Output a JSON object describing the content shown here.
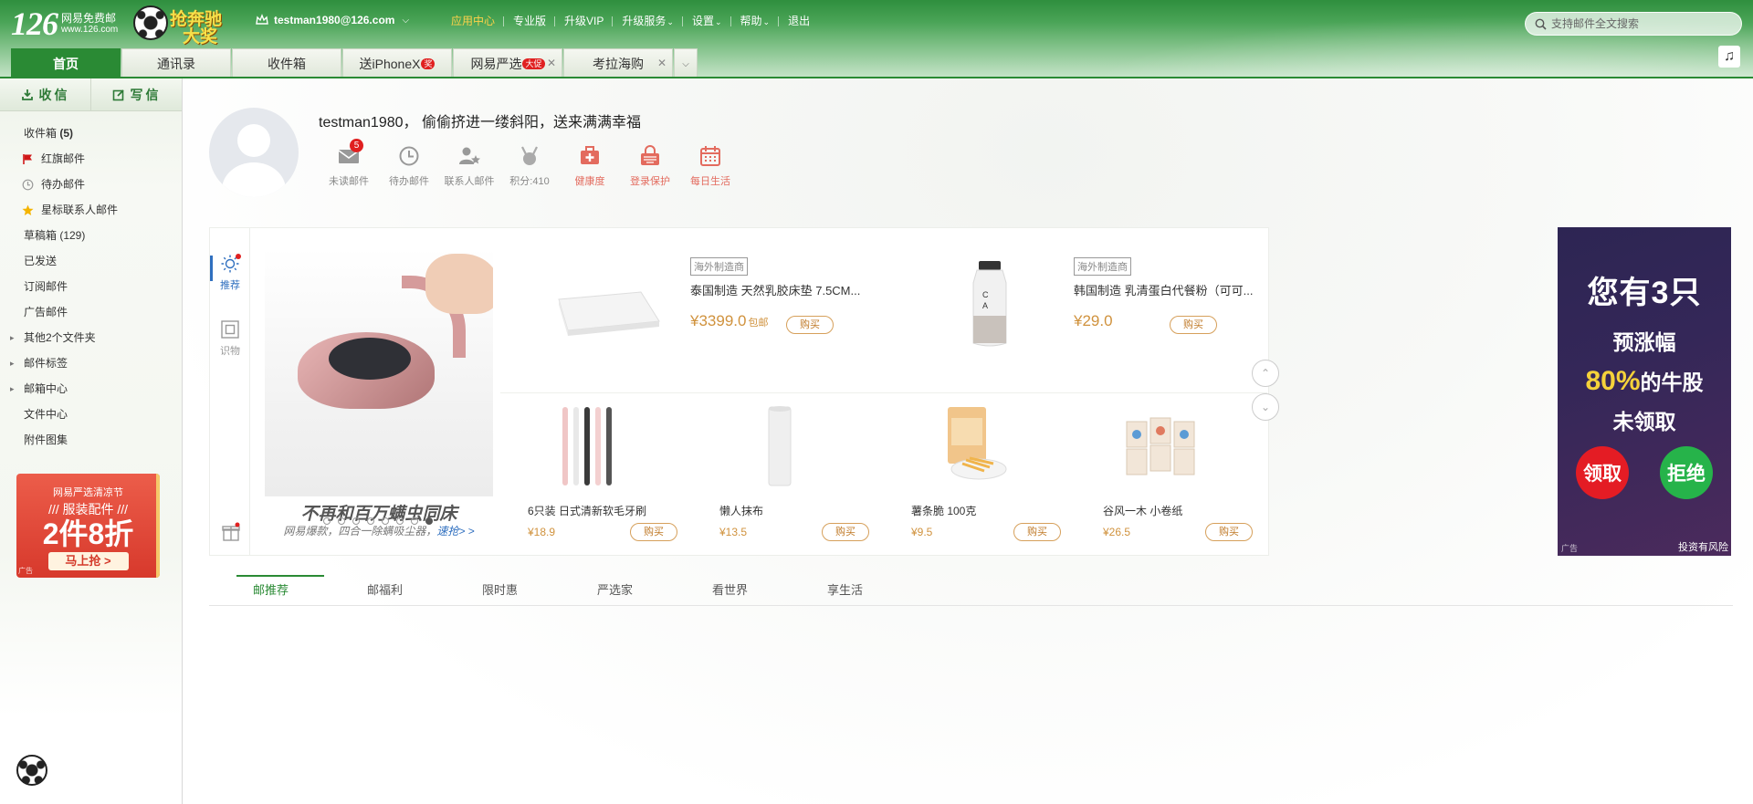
{
  "header": {
    "logo_number": "126",
    "logo_line1": "网易免费邮",
    "logo_line2": "www.126.com",
    "promo_line1": "抢奔驰",
    "promo_line2": "大奖",
    "user_email": "testman1980@126.com",
    "nav": [
      {
        "label": "应用中心",
        "highlight": true,
        "dropdown": false
      },
      {
        "label": "专业版",
        "highlight": false,
        "dropdown": false
      },
      {
        "label": "升级VIP",
        "highlight": false,
        "dropdown": false
      },
      {
        "label": "升级服务",
        "highlight": false,
        "dropdown": true
      },
      {
        "label": "设置",
        "highlight": false,
        "dropdown": true
      },
      {
        "label": "帮助",
        "highlight": false,
        "dropdown": true
      },
      {
        "label": "退出",
        "highlight": false,
        "dropdown": false
      }
    ],
    "search_placeholder": "支持邮件全文搜索"
  },
  "tabs": [
    {
      "label": "首页"
    },
    {
      "label": "通讯录"
    },
    {
      "label": "收件箱"
    },
    {
      "label": "送iPhoneX",
      "badge": "奖"
    },
    {
      "label": "网易严选",
      "badge": "大促"
    },
    {
      "label": "考拉海购"
    }
  ],
  "sidebar": {
    "receive_label": "收信",
    "compose_label": "写信",
    "folders": [
      {
        "label": "收件箱",
        "count": "(5)"
      },
      {
        "label": "红旗邮件",
        "icon": "red-flag-icon"
      },
      {
        "label": "待办邮件",
        "icon": "clock-icon"
      },
      {
        "label": "星标联系人邮件",
        "icon": "star-icon"
      },
      {
        "label": "草稿箱 (129)"
      },
      {
        "label": "已发送"
      },
      {
        "label": "订阅邮件"
      },
      {
        "label": "广告邮件"
      },
      {
        "label": "其他2个文件夹",
        "expandable": true
      },
      {
        "label": "邮件标签",
        "expandable": true
      },
      {
        "label": "邮箱中心",
        "expandable": true
      },
      {
        "label": "文件中心"
      },
      {
        "label": "附件图集"
      }
    ],
    "ad": {
      "line1": "网易严选清凉节",
      "line2": "/// 服装配件 ///",
      "line3": "2件8折",
      "button": "马上抢 >",
      "tag": "广告"
    }
  },
  "main": {
    "greeting": "testman1980， 偷偷挤进一缕斜阳，送来满满幸福",
    "quick_items": [
      {
        "label": "未读邮件",
        "icon": "envelope-icon",
        "badge": "5",
        "red": false
      },
      {
        "label": "待办邮件",
        "icon": "clock-icon",
        "red": false
      },
      {
        "label": "联系人邮件",
        "icon": "contact-star-icon",
        "red": false
      },
      {
        "label": "积分:410",
        "icon": "medal-icon",
        "red": false
      },
      {
        "label": "健康度",
        "icon": "medkit-icon",
        "red": true
      },
      {
        "label": "登录保护",
        "icon": "lock-keyboard-icon",
        "red": true
      },
      {
        "label": "每日生活",
        "icon": "calendar-icon",
        "red": true
      }
    ],
    "shop": {
      "side": [
        {
          "label": "推荐",
          "icon": "sun-icon"
        },
        {
          "label": "识物",
          "icon": "square-icon"
        }
      ],
      "hero_title": "不再和百万螨虫同床",
      "hero_sub": "网易爆款，四合一除螨吸尘器，",
      "hero_link": "速抢> >",
      "big_products": [
        {
          "tag": "海外制造商",
          "name": "泰国制造 天然乳胶床垫 7.5CM...",
          "price": "¥3399.0",
          "note": "包邮",
          "buy": "购买"
        },
        {
          "tag": "海外制造商",
          "name": "韩国制造 乳清蛋白代餐粉（可可...",
          "price": "¥29.0",
          "note": "",
          "buy": "购买"
        }
      ],
      "small_products": [
        {
          "name": "6只装 日式清新软毛牙刷",
          "price": "¥18.9",
          "buy": "购买"
        },
        {
          "name": "懒人抹布",
          "price": "¥13.5",
          "buy": "购买"
        },
        {
          "name": "薯条脆 100克",
          "price": "¥9.5",
          "buy": "购买"
        },
        {
          "name": "谷风一木 小卷纸",
          "price": "¥26.5",
          "buy": "购买"
        }
      ],
      "carousel_count": 8,
      "carousel_active": 8
    },
    "right_ad": {
      "line1": "您有3只",
      "line2": "预涨幅",
      "line3_highlight": "80%",
      "line3_rest": "的牛股",
      "line4": "未领取",
      "accept": "领取",
      "reject": "拒绝",
      "risk": "投资有风险",
      "tag": "广告"
    },
    "bottom_tabs": [
      "邮推荐",
      "邮福利",
      "限时惠",
      "严选家",
      "看世界",
      "享生活"
    ]
  },
  "colors": {
    "brand_green": "#2a8a34",
    "highlight_yellow": "#ffd24a",
    "price_orange": "#d0923d",
    "badge_red": "#e02020"
  }
}
